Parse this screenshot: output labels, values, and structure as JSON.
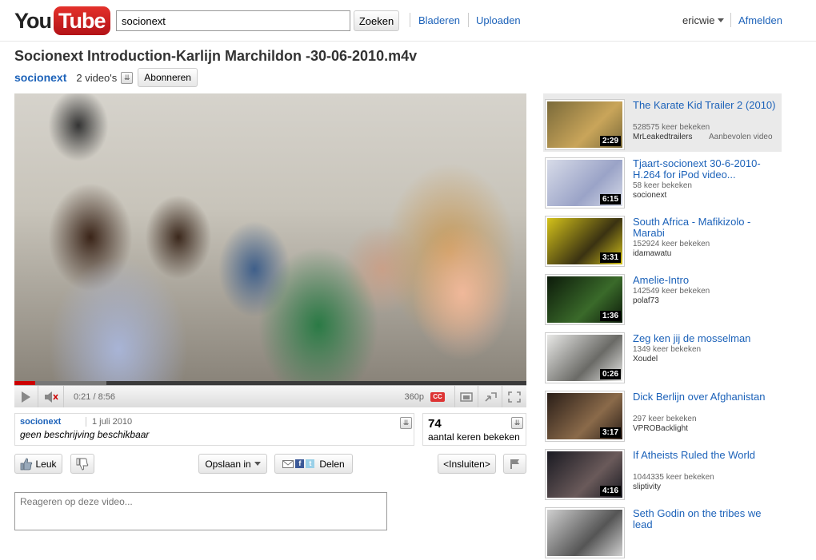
{
  "header": {
    "logo_you": "You",
    "logo_tube": "Tube",
    "search_value": "socionext",
    "search_button": "Zoeken",
    "nav_browse": "Bladeren",
    "nav_upload": "Uploaden",
    "username": "ericwie",
    "signout": "Afmelden"
  },
  "video": {
    "title": "Socionext Introduction-Karlijn Marchildon -30-06-2010.m4v",
    "channel": "socionext",
    "video_count": "2 video's",
    "subscribe": "Abonneren",
    "time": "0:21 / 8:56",
    "quality": "360p",
    "cc": "CC",
    "progress_fraction": 0.04,
    "loaded_fraction": 0.18
  },
  "info": {
    "channel": "socionext",
    "date": "1 juli 2010",
    "description": "geen beschrijving beschikbaar",
    "views": "74",
    "views_label": "aantal keren bekeken"
  },
  "actions": {
    "like": "Leuk",
    "save": "Opslaan in",
    "share": "Delen",
    "embed": "<Insluiten>"
  },
  "comment": {
    "placeholder": "Reageren op deze video..."
  },
  "sidebar": {
    "items": [
      {
        "title": "The Karate Kid Trailer 2 (2010)",
        "views": "528575 keer bekeken",
        "channel": "MrLeakedtrailers",
        "extra": "Aanbevolen video",
        "duration": "2:29",
        "colors": [
          "#7a6a3a",
          "#c9a55a"
        ]
      },
      {
        "title": "Tjaart-socionext 30-6-2010-H.264 for iPod video...",
        "views": "58 keer bekeken",
        "channel": "socionext",
        "extra": "",
        "duration": "6:15",
        "colors": [
          "#d7dbe8",
          "#9aa3c7"
        ]
      },
      {
        "title": "South Africa - Mafikizolo - Marabi",
        "views": "152924 keer bekeken",
        "channel": "idamawatu",
        "extra": "",
        "duration": "3:31",
        "colors": [
          "#d4c21a",
          "#3a3212"
        ]
      },
      {
        "title": "Amelie-Intro",
        "views": "142549 keer bekeken",
        "channel": "polaf73",
        "extra": "",
        "duration": "1:36",
        "colors": [
          "#0c1a0a",
          "#3a6a2a"
        ]
      },
      {
        "title": "Zeg ken jij de mosselman",
        "views": "1349 keer bekeken",
        "channel": "Xoudel",
        "extra": "",
        "duration": "0:26",
        "colors": [
          "#e8e8e6",
          "#6a6a66"
        ]
      },
      {
        "title": "Dick Berlijn over Afghanistan",
        "views": "297 keer bekeken",
        "channel": "VPROBacklight",
        "extra": "",
        "duration": "3:17",
        "colors": [
          "#2a1e18",
          "#8a6a4a"
        ]
      },
      {
        "title": "If Atheists Ruled the World",
        "views": "1044335 keer bekeken",
        "channel": "sliptivity",
        "extra": "",
        "duration": "4:16",
        "colors": [
          "#1a1a22",
          "#6a5a5a"
        ]
      },
      {
        "title": "Seth Godin on the tribes we lead",
        "views": "",
        "channel": "",
        "extra": "",
        "duration": "",
        "colors": [
          "#cfcfcf",
          "#555"
        ]
      }
    ]
  }
}
